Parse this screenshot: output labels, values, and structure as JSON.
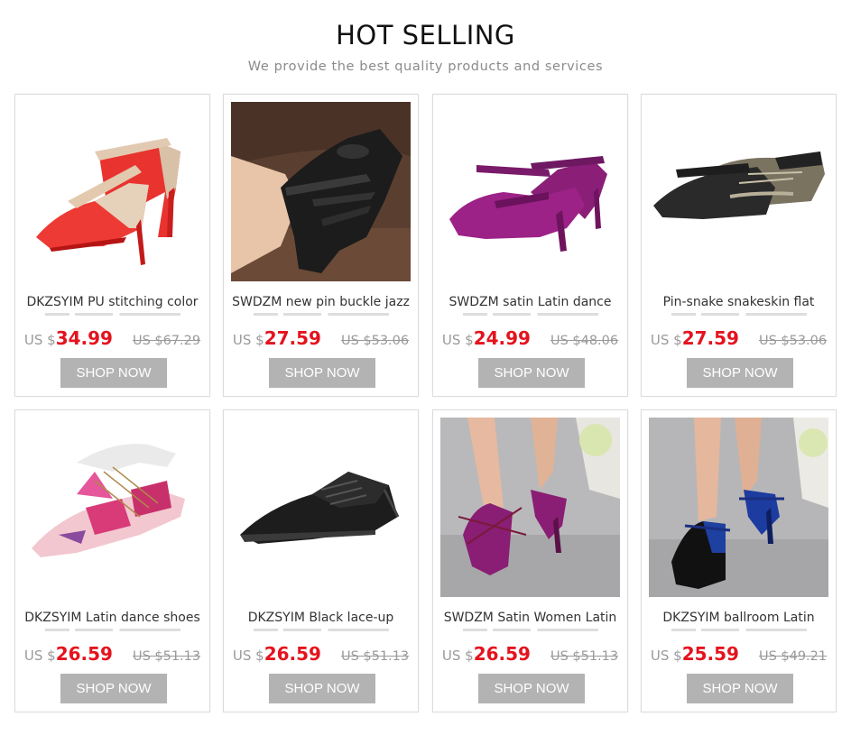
{
  "header": {
    "title": "HOT SELLING",
    "subtitle": "We provide the best quality products and services"
  },
  "products": [
    {
      "name": "DKZSYIM PU stitching color",
      "currency": "US $",
      "price": "34.99",
      "old_price": "US $67.29",
      "button": "SHOP NOW",
      "image_icon": "red-beige-heel-shoe-icon"
    },
    {
      "name": "SWDZM new pin buckle jazz",
      "currency": "US $",
      "price": "27.59",
      "old_price": "US $53.06",
      "button": "SHOP NOW",
      "image_icon": "black-strap-shoe-photo-icon"
    },
    {
      "name": "SWDZM satin Latin dance",
      "currency": "US $",
      "price": "24.99",
      "old_price": "US $48.06",
      "button": "SHOP NOW",
      "image_icon": "purple-satin-heel-icon"
    },
    {
      "name": "Pin-snake snakeskin flat",
      "currency": "US $",
      "price": "27.59",
      "old_price": "US $53.06",
      "button": "SHOP NOW",
      "image_icon": "snakeskin-flat-shoes-icon"
    },
    {
      "name": "DKZSYIM Latin dance shoes",
      "currency": "US $",
      "price": "26.59",
      "old_price": "US $51.13",
      "button": "SHOP NOW",
      "image_icon": "floral-lace-up-flat-icon"
    },
    {
      "name": "DKZSYIM Black lace-up",
      "currency": "US $",
      "price": "26.59",
      "old_price": "US $51.13",
      "button": "SHOP NOW",
      "image_icon": "black-lace-up-shoe-icon"
    },
    {
      "name": "SWDZM Satin Women Latin",
      "currency": "US $",
      "price": "26.59",
      "old_price": "US $51.13",
      "button": "SHOP NOW",
      "image_icon": "purple-satin-worn-heel-icon"
    },
    {
      "name": "DKZSYIM ballroom Latin",
      "currency": "US $",
      "price": "25.59",
      "old_price": "US $49.21",
      "button": "SHOP NOW",
      "image_icon": "blue-black-ballroom-heel-icon"
    }
  ],
  "colors": {
    "price_red": "#e4131e",
    "button_gray": "#b3b3b3",
    "muted_text": "#9a9a9a"
  }
}
